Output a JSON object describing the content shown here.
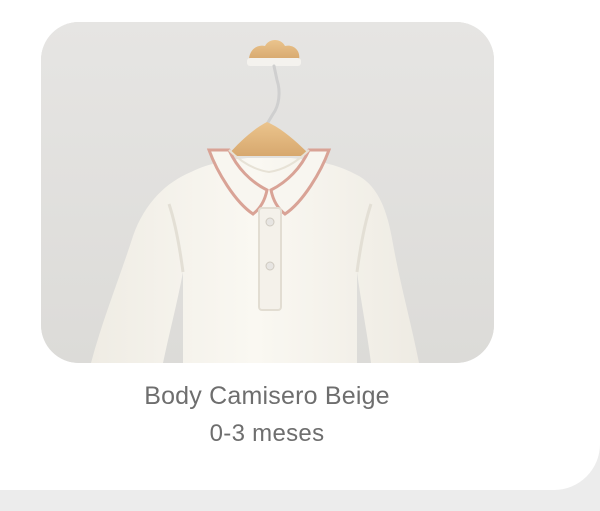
{
  "product": {
    "name": "Body Camisero Beige",
    "size": "0-3 meses",
    "image_icon": "product-photo",
    "colors": {
      "background_wall": "#e3e2e0",
      "garment": "#f7f5ef",
      "collar_trim": "#d9a396",
      "hanger_wood": "#e2b880",
      "text": "#6e6e6e"
    }
  }
}
